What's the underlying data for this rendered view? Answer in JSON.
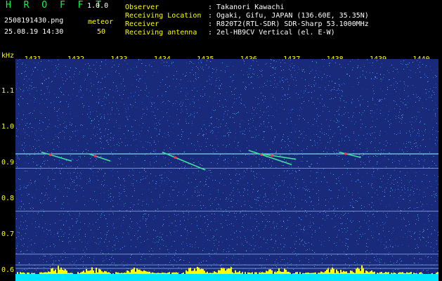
{
  "app": {
    "title": "H R O F F T",
    "version": "1.0.0"
  },
  "file": {
    "filename": "2508191430.png",
    "datetime": "25.08.19 14:30",
    "count_label": "meteor",
    "count_value": "50"
  },
  "station": {
    "observer_label": "Observer",
    "observer_value": ": Takanori Kawachi",
    "location_label": "Receiving Location",
    "location_value": ": Ogaki, Gifu, JAPAN (136.60E, 35.35N)",
    "receiver_label": "Receiver",
    "receiver_value": ": R820T2(RTL-SDR) SDR-Sharp 53.1000MHz",
    "antenna_label": "Receiving antenna",
    "antenna_value": ": 2el-HB9CV Vertical (el. E-W)"
  },
  "colors": {
    "background": "#000000",
    "spectrogram_bg": "#1a2a7a",
    "label_yellow": "#ffff00",
    "title_green": "#00ff44",
    "bottom_bar": "#00e5ff"
  },
  "chart_data": {
    "type": "heatmap",
    "ylabel": "kHz",
    "x_ticks": [
      "1431",
      "1432",
      "1433",
      "1434",
      "1435",
      "1436",
      "1437",
      "1438",
      "1439",
      "1440"
    ],
    "y_ticks": [
      "1.1",
      "1.0",
      "0.9",
      "0.8",
      "0.7",
      "0.6"
    ],
    "ylim": [
      0.57,
      1.19
    ],
    "xlim": [
      1430.6,
      1440.4
    ],
    "grid": false,
    "horizontal_lines_khz": [
      0.925,
      0.885,
      0.765,
      0.645,
      0.615,
      0.605
    ],
    "meteor_echoes": [
      {
        "x0": 1431.2,
        "y0": 0.93,
        "x1": 1431.9,
        "y1": 0.905
      },
      {
        "x0": 1432.3,
        "y0": 0.925,
        "x1": 1432.8,
        "y1": 0.905
      },
      {
        "x0": 1434.0,
        "y0": 0.93,
        "x1": 1435.0,
        "y1": 0.88
      },
      {
        "x0": 1436.0,
        "y0": 0.935,
        "x1": 1437.0,
        "y1": 0.895
      },
      {
        "x0": 1436.3,
        "y0": 0.925,
        "x1": 1437.1,
        "y1": 0.91
      },
      {
        "x0": 1438.1,
        "y0": 0.93,
        "x1": 1438.6,
        "y1": 0.915
      }
    ]
  }
}
